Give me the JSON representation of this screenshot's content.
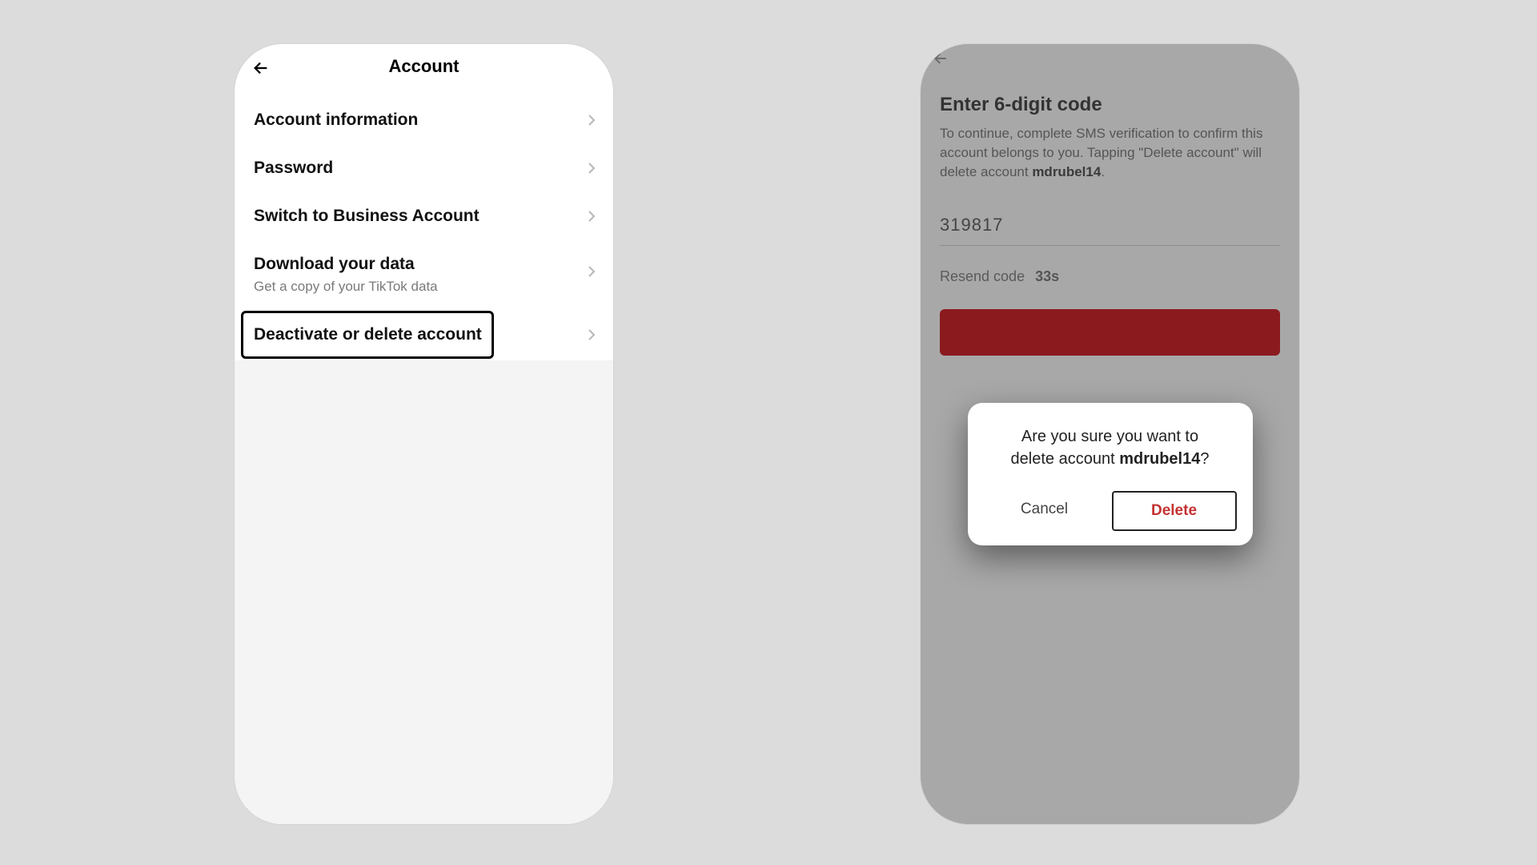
{
  "left": {
    "title": "Account",
    "rows": {
      "account_info": "Account information",
      "password": "Password",
      "business": "Switch to Business Account",
      "download": "Download your data",
      "download_sub": "Get a copy of your TikTok data",
      "deactivate": "Deactivate or delete account"
    }
  },
  "right": {
    "title": "Enter 6-digit code",
    "desc_pre": "To continue, complete SMS verification to confirm this account belongs to you. Tapping \"Delete account\" will delete account ",
    "desc_user": "mdrubel14",
    "desc_post": ".",
    "code_value": "319817",
    "resend_label": "Resend code",
    "resend_timer": "33s"
  },
  "dialog": {
    "line1": "Are you sure you want to",
    "line2_pre": "delete account ",
    "line2_user": "mdrubel14",
    "line2_post": "?",
    "cancel": "Cancel",
    "delete": "Delete"
  }
}
